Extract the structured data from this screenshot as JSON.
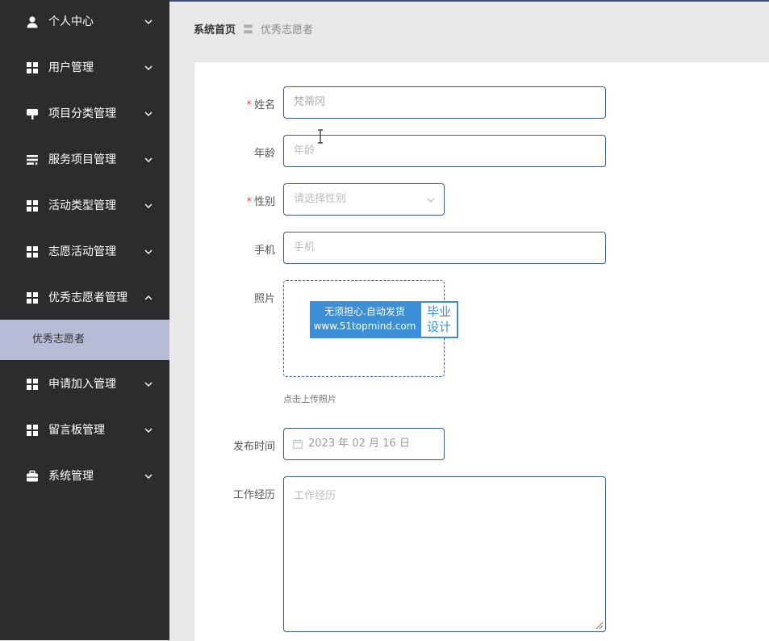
{
  "sidebar": {
    "items": [
      {
        "label": "个人中心",
        "icon": "user-icon"
      },
      {
        "label": "用户管理",
        "icon": "grid-icon"
      },
      {
        "label": "项目分类管理",
        "icon": "pin-icon"
      },
      {
        "label": "服务项目管理",
        "icon": "list-icon"
      },
      {
        "label": "活动类型管理",
        "icon": "grid-icon"
      },
      {
        "label": "志愿活动管理",
        "icon": "grid-icon"
      },
      {
        "label": "优秀志愿者管理",
        "icon": "grid-icon",
        "expanded": true
      },
      {
        "label": "申请加入管理",
        "icon": "grid-icon"
      },
      {
        "label": "留言板管理",
        "icon": "grid-icon"
      },
      {
        "label": "系统管理",
        "icon": "briefcase-icon"
      }
    ],
    "active_subitem": "优秀志愿者"
  },
  "breadcrumb": {
    "home": "系统首页",
    "separator": "〓",
    "current": "优秀志愿者"
  },
  "form": {
    "name": {
      "label": "姓名",
      "required_mark": "*",
      "value": "梵蒂冈"
    },
    "age": {
      "label": "年龄",
      "placeholder": "年龄"
    },
    "gender": {
      "label": "性别",
      "required_mark": "*",
      "placeholder": "请选择性别"
    },
    "phone": {
      "label": "手机",
      "placeholder": "手机"
    },
    "photo": {
      "label": "照片",
      "tip": "点击上传照片"
    },
    "publish_time": {
      "label": "发布时间",
      "value": "2023 年 02 月 16 日"
    },
    "experience": {
      "label": "工作经历",
      "placeholder": "工作经历"
    }
  },
  "watermark": {
    "line1": "无须担心.自动发货",
    "line2": "www.51topmind.com",
    "right_line1": "毕业",
    "right_line2": "设计"
  },
  "colors": {
    "sidebar_bg": "#2b2c2c",
    "active_sub_bg": "#b6bbd6",
    "input_border": "#3d5a9a",
    "required": "#e04848",
    "watermark_blue": "#3a8fd6"
  }
}
